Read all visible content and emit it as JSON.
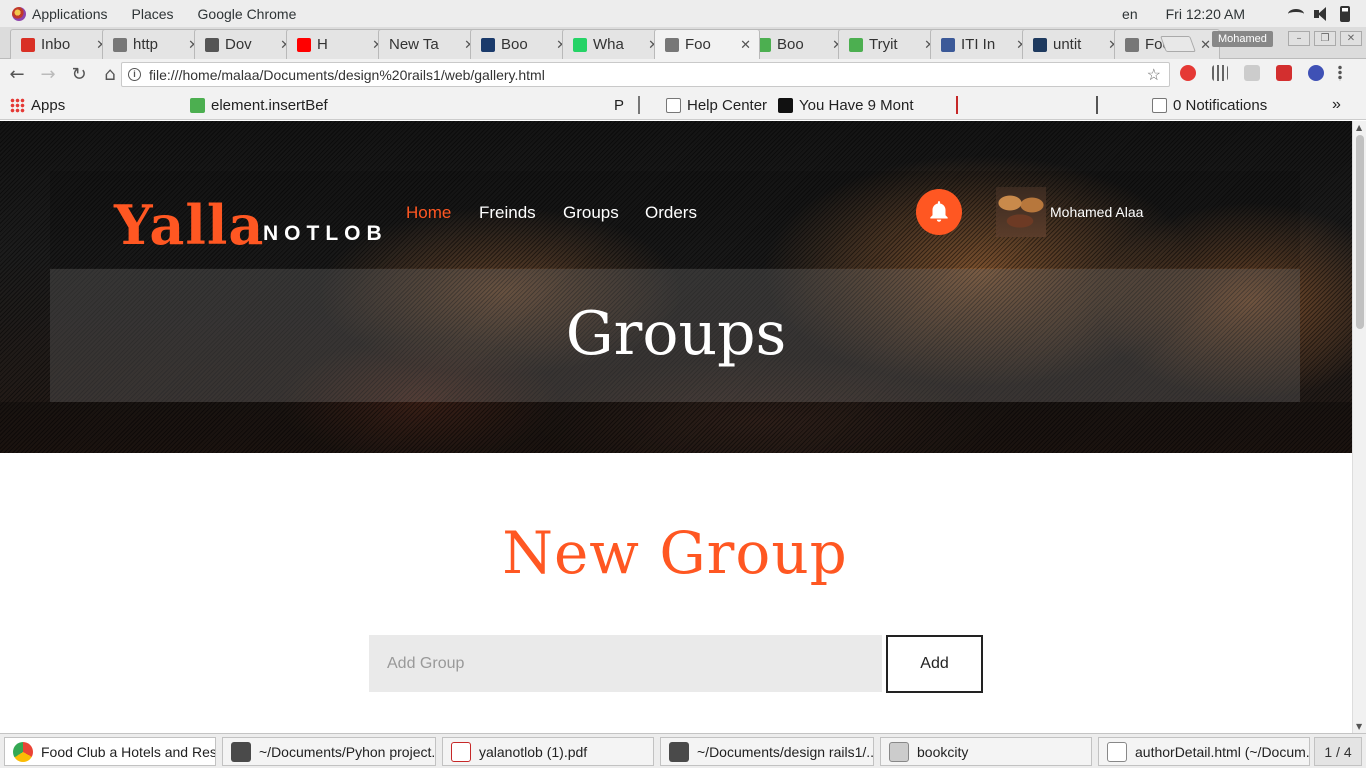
{
  "top_bar": {
    "applications": "Applications",
    "places": "Places",
    "active_app": "Google Chrome",
    "language": "en",
    "clock": "Fri 12:20 AM"
  },
  "browser": {
    "tabs": [
      {
        "label": "Inbo",
        "icon": "gmail-icon",
        "color": "#d93025"
      },
      {
        "label": "http",
        "icon": "page-icon",
        "color": "#777777"
      },
      {
        "label": "Dov",
        "icon": "download-icon",
        "color": "#555555"
      },
      {
        "label": "H",
        "icon": "youtube-icon",
        "color": "#ff0000"
      },
      {
        "label": "New Ta",
        "icon": "none",
        "color": "#e4e4e4"
      },
      {
        "label": "Boo",
        "icon": "bookmark-b-icon",
        "color": "#1a3a6b"
      },
      {
        "label": "Wha",
        "icon": "whatsapp-icon",
        "color": "#25d366"
      },
      {
        "label": "Foo",
        "icon": "page-icon",
        "color": "#777777"
      },
      {
        "label": "Boo",
        "icon": "w3-icon",
        "color": "#4caf50"
      },
      {
        "label": "Tryit",
        "icon": "w3-icon",
        "color": "#4caf50"
      },
      {
        "label": "ITI In",
        "icon": "facebook-icon",
        "color": "#3b5998"
      },
      {
        "label": "untit",
        "icon": "q-icon",
        "color": "#1e3a5f"
      },
      {
        "label": "Foo",
        "icon": "page-icon",
        "color": "#777777"
      }
    ],
    "active_tab_index": 7,
    "profile_name": "Mohamed",
    "url": "file:///home/malaa/Documents/design%20rails1/web/gallery.html",
    "bookmarks": [
      {
        "label": "Apps",
        "icon": "apps-grid-icon"
      },
      {
        "label": "element.insertBef",
        "icon": "w3-icon"
      },
      {
        "label": "Help Center",
        "icon": "page-icon"
      },
      {
        "label": "You Have 9 Mont",
        "icon": "i-icon"
      },
      {
        "label": "0 Notifications",
        "icon": "page-icon"
      }
    ],
    "bookmark_p_label": "P",
    "overflow_label": "»"
  },
  "site": {
    "logo_main": "Yalla",
    "logo_sub": "NOTLOB",
    "nav": [
      "Home",
      "Freinds",
      "Groups",
      "Orders"
    ],
    "active_nav_index": 0,
    "user_name": "Mohamed Alaa",
    "page_title": "Groups",
    "section_title": "New Group",
    "group_input": {
      "placeholder": "Add Group",
      "value": ""
    },
    "add_button": "Add",
    "accent_color": "#ff5722"
  },
  "taskbar": {
    "windows": [
      "Food Club a Hotels and Res...",
      "~/Documents/Pyhon project...",
      "yalanotlob (1).pdf",
      "~/Documents/design rails1/...",
      "bookcity",
      "authorDetail.html (~/Docum..."
    ],
    "workspace": "1 / 4"
  }
}
